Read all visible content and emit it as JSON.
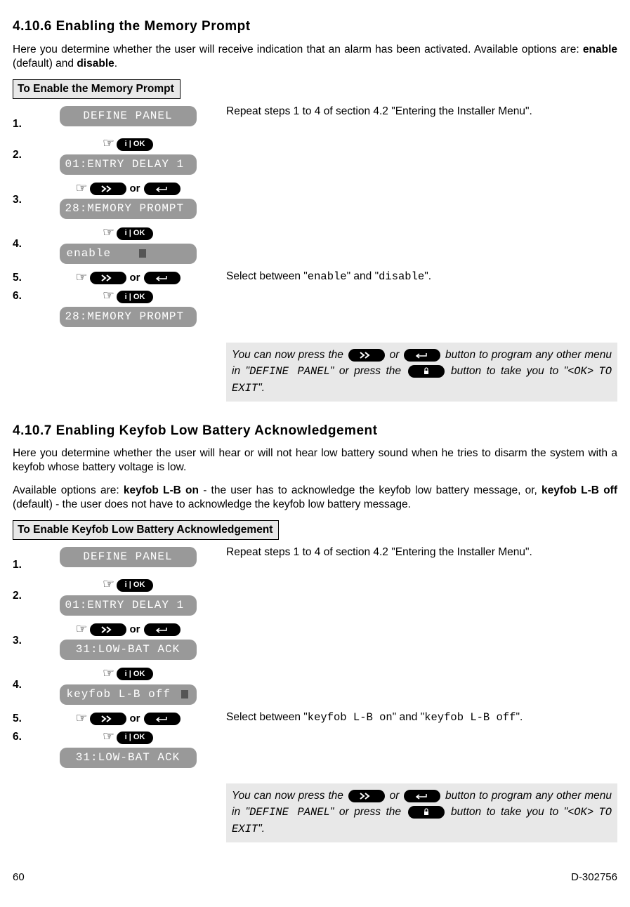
{
  "section1": {
    "heading": "4.10.6 Enabling the Memory Prompt",
    "intro_pre": "Here you determine whether the user will receive indication that an alarm has been activated.\nAvailable options are: ",
    "opt1": "enable",
    "intro_mid": " (default) and ",
    "opt2": "disable",
    "intro_end": ".",
    "box_title": "To Enable the Memory Prompt",
    "steps": {
      "s1": "1.",
      "s2": "2.",
      "s3": "3.",
      "s4": "4.",
      "s5": "5.",
      "s6": "6."
    },
    "lcd": {
      "define_panel": "DEFINE PANEL",
      "entry_delay": "01:ENTRY DELAY 1",
      "memory_prompt": "28:MEMORY PROMPT",
      "enable": "enable"
    },
    "repeat_text": "Repeat steps 1 to 4 of section 4.2 \"Entering the Installer Menu\".",
    "select_pre": "Select between \"",
    "select_opt1": "enable",
    "select_mid": "\" and \"",
    "select_opt2": "disable",
    "select_end": "\".",
    "or": "or",
    "note": {
      "p1": "You can now press the ",
      "p2": " or ",
      "p3": " button to program any other menu in \"",
      "mono1": "DEFINE PANEL",
      "p4": "\" or press the ",
      "p5": " button to take you to \"<",
      "mono2": "OK",
      "p6": "> ",
      "mono3": "TO EXIT",
      "p7": "\"."
    }
  },
  "section2": {
    "heading": "4.10.7 Enabling Keyfob Low Battery Acknowledgement",
    "intro_line1": "Here you determine whether the user will hear or will not hear low battery sound when he tries to disarm the system with a keyfob whose battery voltage is low.",
    "intro_pre": "Available options are: ",
    "opt1": "keyfob L-B on",
    "intro_mid1": " - the user has to acknowledge the keyfob low battery message, or, ",
    "opt2": "keyfob L-B off",
    "intro_mid2": " (default) - the user does not have to acknowledge the keyfob low battery message.",
    "box_title": "To Enable Keyfob Low Battery Acknowledgement",
    "steps": {
      "s1": "1.",
      "s2": "2.",
      "s3": "3.",
      "s4": "4.",
      "s5": "5.",
      "s6": "6."
    },
    "lcd": {
      "define_panel": "DEFINE PANEL",
      "entry_delay": "01:ENTRY DELAY 1",
      "low_bat": "31:LOW-BAT ACK",
      "keyfob_off": "keyfob L-B off"
    },
    "repeat_text": "Repeat steps 1 to 4 of section 4.2 \"Entering the Installer Menu\".",
    "select_pre": "Select between \"",
    "select_opt1": "keyfob L-B on",
    "select_mid": "\" and \"",
    "select_opt2": "keyfob L-B off",
    "select_end": "\".",
    "or": "or",
    "note": {
      "p1": "You can now press the ",
      "p2": " or ",
      "p3": " button to program any other menu in \"",
      "mono1": "DEFINE PANEL",
      "p4": "\" or press the ",
      "p5": " button to take you to \"<",
      "mono2": "OK",
      "p6": "> ",
      "mono3": "TO EXIT",
      "p7": "\"."
    }
  },
  "footer": {
    "page": "60",
    "doc": "D-302756"
  },
  "labels": {
    "ok": "i | OK"
  }
}
